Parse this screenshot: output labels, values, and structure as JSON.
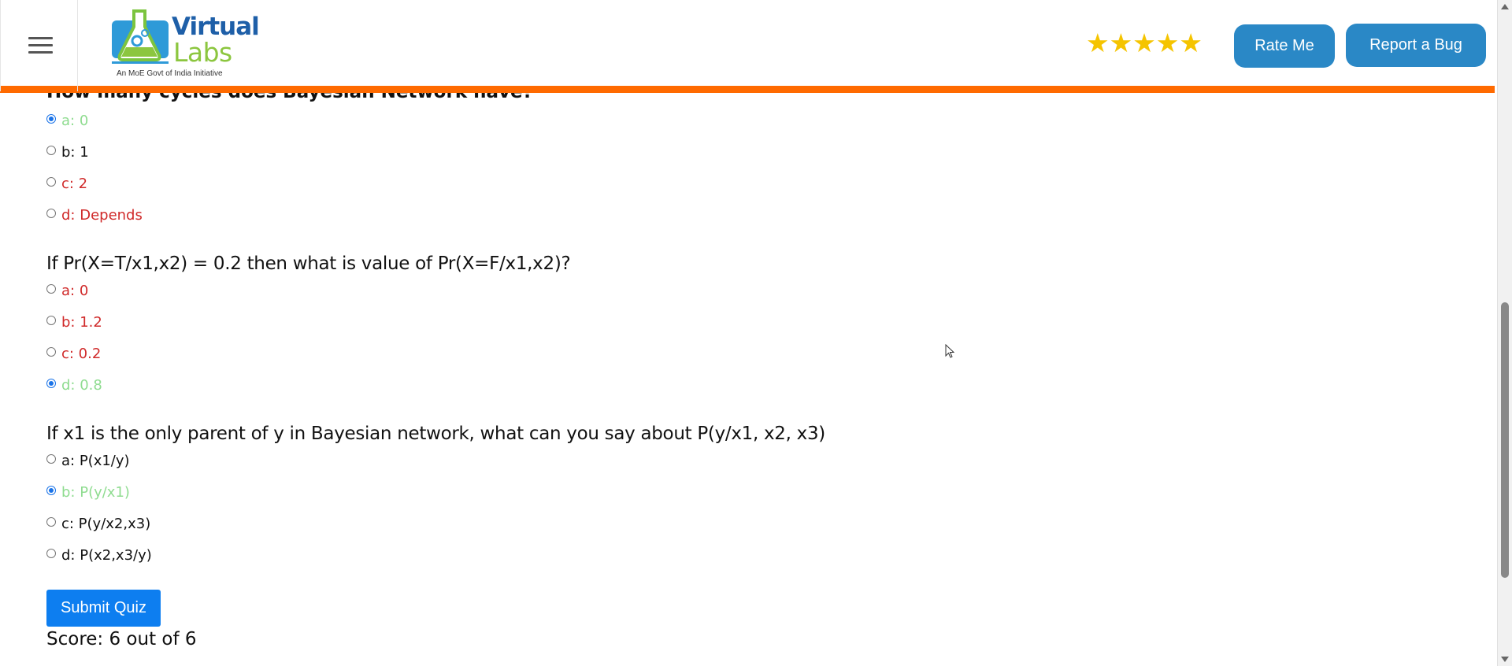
{
  "header": {
    "logo": {
      "line1": "Virtual",
      "line2": "Labs",
      "tagline": "An MoE Govt of India Initiative"
    },
    "rating_stars": 5,
    "rate_button": "Rate Me",
    "bug_button": "Report a Bug"
  },
  "quiz": {
    "cut_question": "How many cycles does Bayesian Network have?",
    "q_cut_options": [
      {
        "label": "a: 0",
        "checked": true,
        "color": "green"
      },
      {
        "label": "b: 1",
        "checked": false,
        "color": "black"
      },
      {
        "label": "c: 2",
        "checked": false,
        "color": "red"
      },
      {
        "label": "d: Depends",
        "checked": false,
        "color": "red"
      }
    ],
    "q2": {
      "text": "If Pr(X=T/x1,x2) = 0.2 then what is value of Pr(X=F/x1,x2)?",
      "options": [
        {
          "label": "a: 0",
          "checked": false,
          "color": "red"
        },
        {
          "label": "b: 1.2",
          "checked": false,
          "color": "red"
        },
        {
          "label": "c: 0.2",
          "checked": false,
          "color": "red"
        },
        {
          "label": "d: 0.8",
          "checked": true,
          "color": "green"
        }
      ]
    },
    "q3": {
      "text": "If x1 is the only parent of y in Bayesian network, what can you say about P(y/x1, x2, x3)",
      "options": [
        {
          "label": "a: P(x1/y)",
          "checked": false,
          "color": "black"
        },
        {
          "label": "b: P(y/x1)",
          "checked": true,
          "color": "green"
        },
        {
          "label": "c: P(y/x2,x3)",
          "checked": false,
          "color": "black"
        },
        {
          "label": "d: P(x2,x3/y)",
          "checked": false,
          "color": "black"
        }
      ]
    },
    "submit_label": "Submit Quiz",
    "score_text": "Score: 6 out of 6"
  },
  "colors": {
    "accent_orange": "#ff6a00",
    "button_blue": "#2a88c6",
    "submit_blue": "#0d7ef0",
    "correct_green": "#8fdc90",
    "wrong_red": "#d02a2a",
    "star_yellow": "#f5c400"
  }
}
